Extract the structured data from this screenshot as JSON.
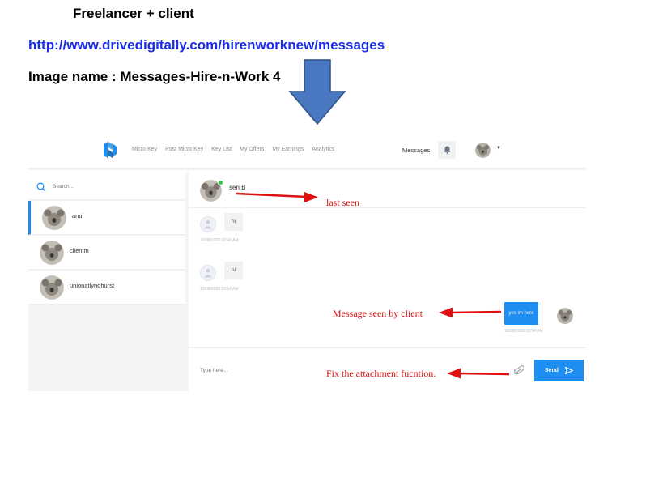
{
  "document": {
    "title": "Freelancer + client",
    "url": "http://www.drivedigitally.com/hirenworknew/messages",
    "image_name": "Image name : Messages-Hire-n-Work 4"
  },
  "nav": {
    "items": [
      "Micro Key",
      "Post Micro Key",
      "Key List",
      "My Offers",
      "My Earnings",
      "Analytics"
    ],
    "messages_label": "Messages"
  },
  "sidebar": {
    "search_placeholder": "Search...",
    "contacts": [
      {
        "name": "anuj",
        "active": true
      },
      {
        "name": "clientm",
        "active": false
      },
      {
        "name": "unionatlyndhurst",
        "active": false
      }
    ]
  },
  "chat": {
    "contact_name": "sen B",
    "status": "",
    "messages": [
      {
        "direction": "in",
        "text": "hi",
        "timestamp": "10/08/2020 02:43 AM"
      },
      {
        "direction": "in",
        "text": "hi",
        "timestamp": "10/08/2020 03:54 AM"
      },
      {
        "direction": "out",
        "text": "yes im here",
        "timestamp": "10/08/2020 03:54 AM"
      }
    ],
    "input_placeholder": "Type here...",
    "send_label": "Send"
  },
  "annotations": {
    "last_seen": "last seen",
    "message_seen": "Message seen by client",
    "fix_attachment": "Fix the attachment fucntion."
  },
  "colors": {
    "accent": "#1f8ef1",
    "annotation": "#e01010",
    "big_arrow": "#4a78c0"
  },
  "icons": [
    "logo-icon",
    "search-icon",
    "bell-icon",
    "paperclip-icon",
    "send-arrow-icon",
    "down-arrow-icon"
  ]
}
